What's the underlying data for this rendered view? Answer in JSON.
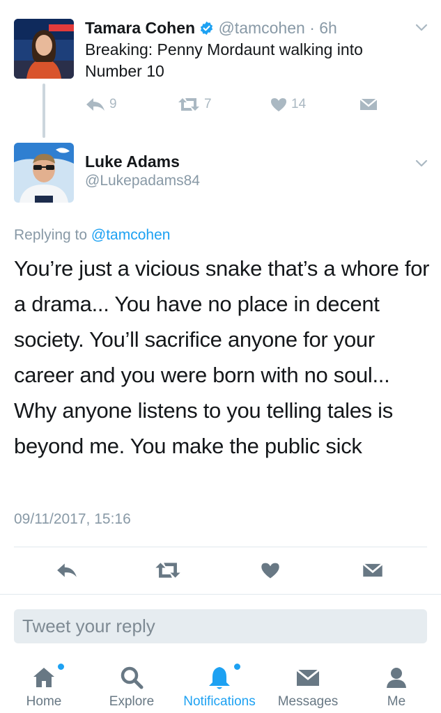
{
  "parent_tweet": {
    "name": "Tamara Cohen",
    "handle_time": "@tamcohen · 6h",
    "text": "Breaking: Penny Mordaunt walking into Number 10",
    "replies": "9",
    "retweets": "7",
    "likes": "14"
  },
  "main_tweet": {
    "name": "Luke Adams",
    "handle": "@Lukepadams84",
    "replying_prefix": "Replying to ",
    "replying_mention": "@tamcohen",
    "text": "You’re just a vicious snake that’s a whore for a drama... You have no place in decent society. You’ll sacrifice anyone for your career and you were born with no soul... Why anyone listens to you telling tales is beyond me. You make the public sick",
    "timestamp": "09/11/2017, 15:16"
  },
  "reply_box": {
    "placeholder": "Tweet your reply"
  },
  "tabbar": {
    "home": "Home",
    "explore": "Explore",
    "notifications": "Notifications",
    "messages": "Messages",
    "me": "Me"
  },
  "icons": {
    "reply": "reply-icon",
    "retweet": "retweet-icon",
    "like": "heart-icon",
    "dm": "envelope-icon",
    "verified": "verified-badge-icon",
    "more": "chevron-down-icon"
  },
  "colors": {
    "accent": "#1da1f2",
    "muted": "#8899a6",
    "action_gray": "#aab8c2",
    "text": "#14171a"
  }
}
